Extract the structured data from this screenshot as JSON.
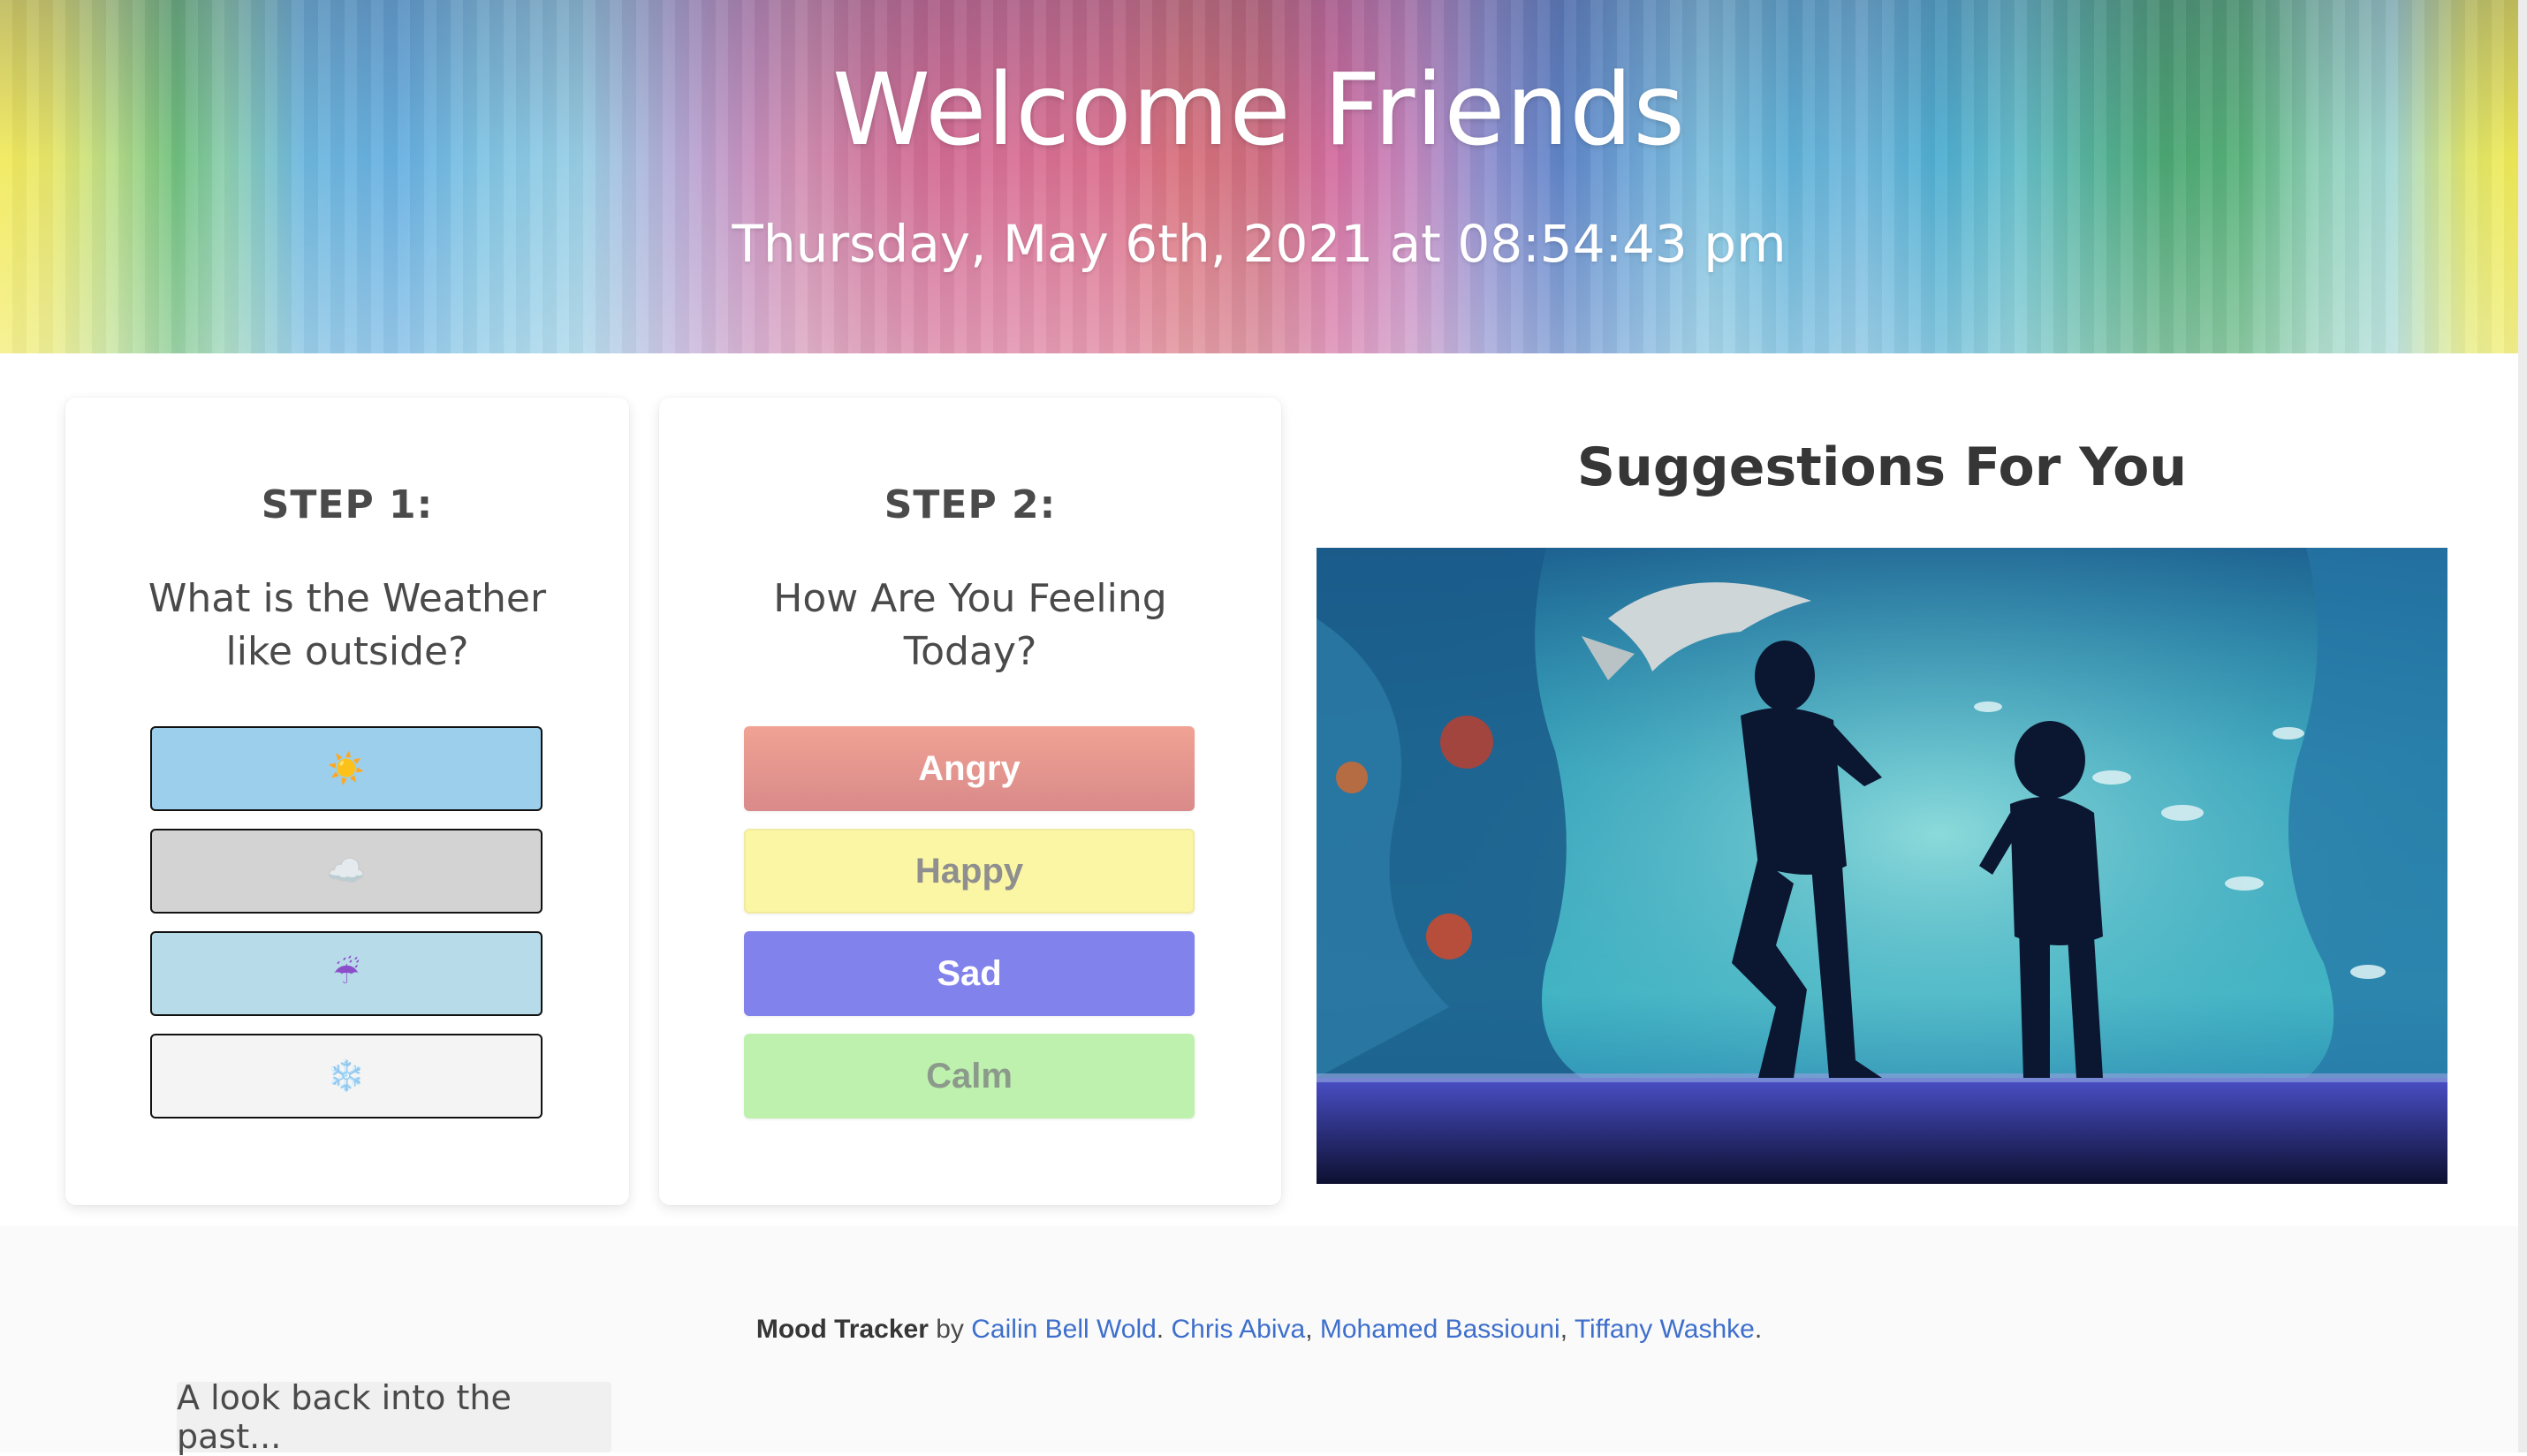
{
  "hero": {
    "title": "Welcome Friends",
    "datetime": "Thursday, May 6th, 2021 at 08:54:43 pm"
  },
  "step1": {
    "title": "STEP 1:",
    "question": "What is the Weather like outside?",
    "options": [
      {
        "icon": "☀️",
        "icon_name": "sun-icon",
        "bg": "#9ccfec"
      },
      {
        "icon": "☁️",
        "icon_name": "cloud-icon",
        "bg": "#d3d3d3"
      },
      {
        "icon": "☔",
        "icon_name": "umbrella-rain-icon",
        "bg": "#b7dbe8"
      },
      {
        "icon": "❄️",
        "icon_name": "snowflake-icon",
        "bg": "#f4f4f4"
      }
    ]
  },
  "step2": {
    "title": "STEP 2:",
    "question": "How Are You Feeling Today?",
    "moods": [
      {
        "label": "Angry",
        "color": "#e5968e"
      },
      {
        "label": "Happy",
        "color": "#fbf6a4"
      },
      {
        "label": "Sad",
        "color": "#8182ec"
      },
      {
        "label": "Calm",
        "color": "#bdf1ad"
      }
    ]
  },
  "suggestions": {
    "title": "Suggestions For You"
  },
  "footer": {
    "app_name": "Mood Tracker",
    "by": "by",
    "authors": [
      "Cailin Bell Wold",
      "Chris Abiva",
      "Mohamed Bassiouni",
      "Tiffany Washke"
    ],
    "sep1": ". ",
    "sep2": ", ",
    "sep3": ", ",
    "end": ".",
    "past_label": "A look back into the past..."
  }
}
